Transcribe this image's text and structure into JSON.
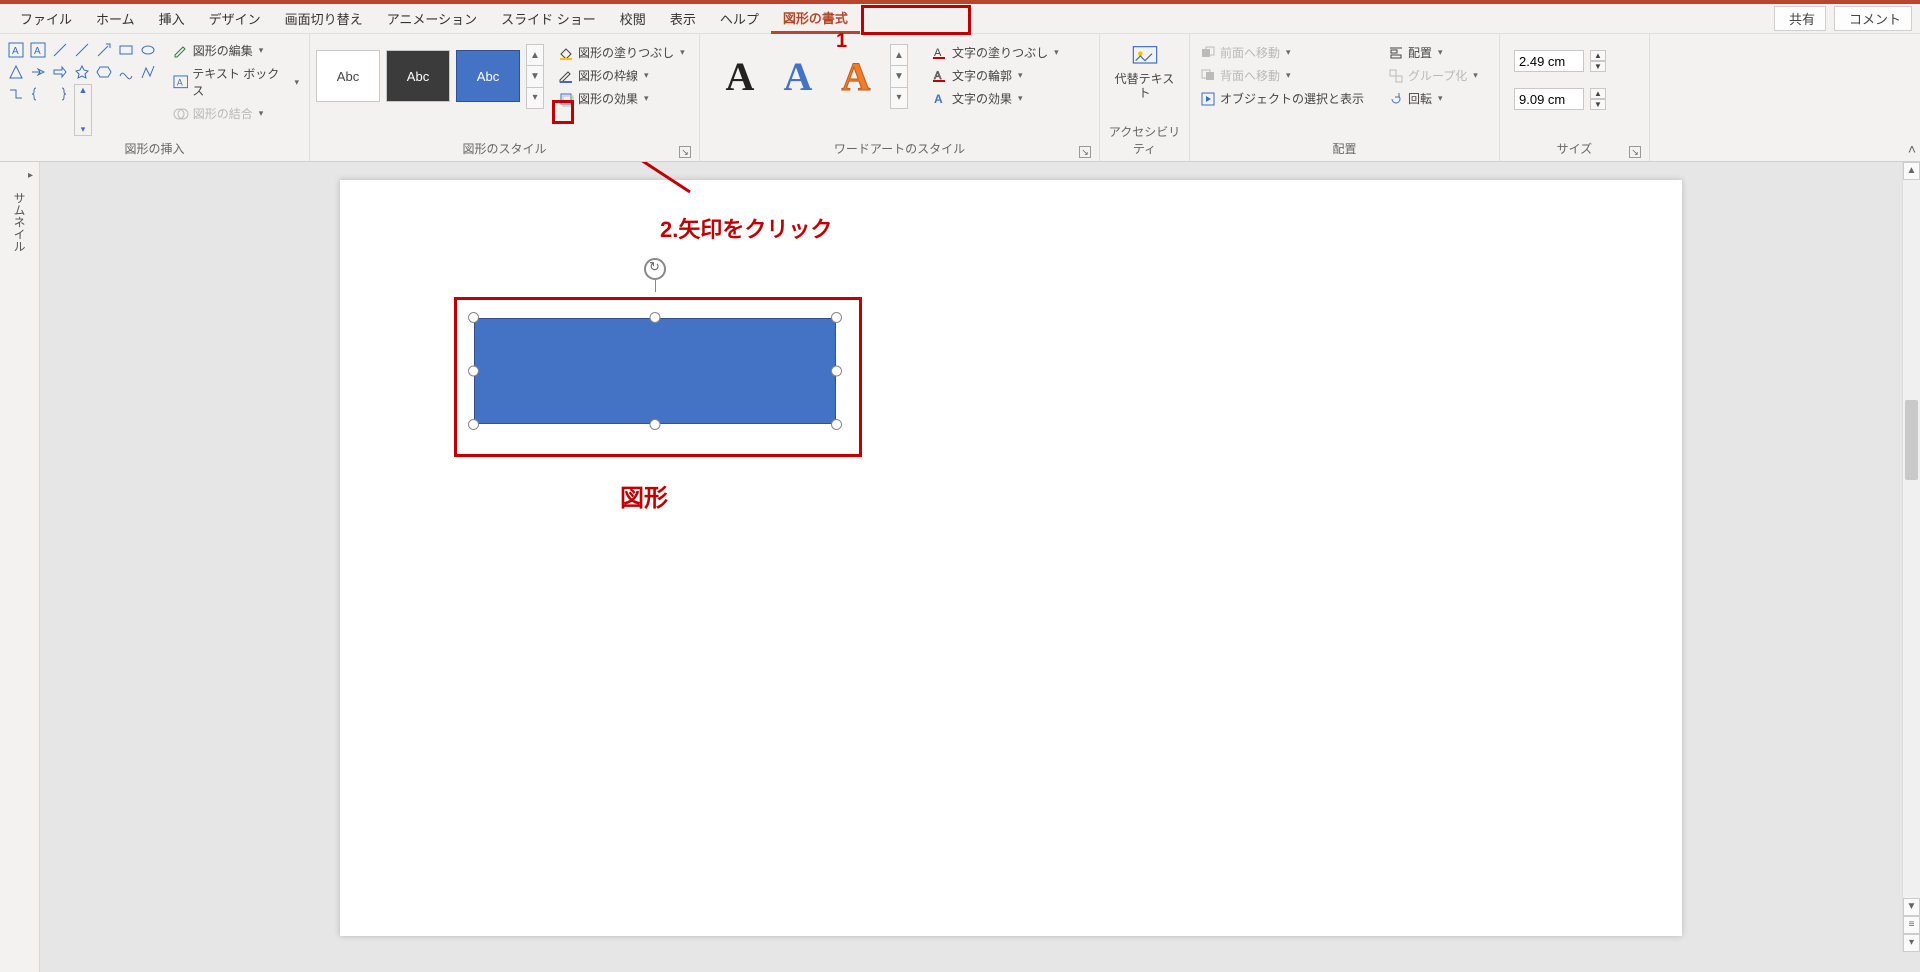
{
  "tabs": {
    "file": "ファイル",
    "home": "ホーム",
    "insert": "挿入",
    "design": "デザイン",
    "transition": "画面切り替え",
    "animation": "アニメーション",
    "slideshow": "スライド ショー",
    "review": "校閲",
    "view": "表示",
    "help": "ヘルプ",
    "format": "図形の書式"
  },
  "right_buttons": {
    "share": "共有",
    "comment": "コメント"
  },
  "groups": {
    "insert_shapes": "図形の挿入",
    "edit_shape": "図形の編集",
    "text_box": "テキスト ボックス",
    "merge": "図形の結合",
    "shape_styles": "図形のスタイル",
    "fill": "図形の塗りつぶし",
    "outline": "図形の枠線",
    "effects": "図形の効果",
    "wordart": "ワードアートのスタイル",
    "text_fill": "文字の塗りつぶし",
    "text_outline": "文字の輪郭",
    "text_effects": "文字の効果",
    "accessibility": "アクセシビリティ",
    "alt_text": "代替テキスト",
    "arrange": "配置",
    "bring_forward": "前面へ移動",
    "send_backward": "背面へ移動",
    "selection_pane": "オブジェクトの選択と表示",
    "align": "配置",
    "group": "グループ化",
    "rotate": "回転",
    "size": "サイズ"
  },
  "style_thumb_label": "Abc",
  "wordart_letter": "A",
  "size_values": {
    "height": "2.49 cm",
    "width": "9.09 cm"
  },
  "side_panel": "サムネイル",
  "annotations": {
    "num1": "1",
    "step2": "2.矢印をクリック",
    "shape_label": "図形"
  }
}
